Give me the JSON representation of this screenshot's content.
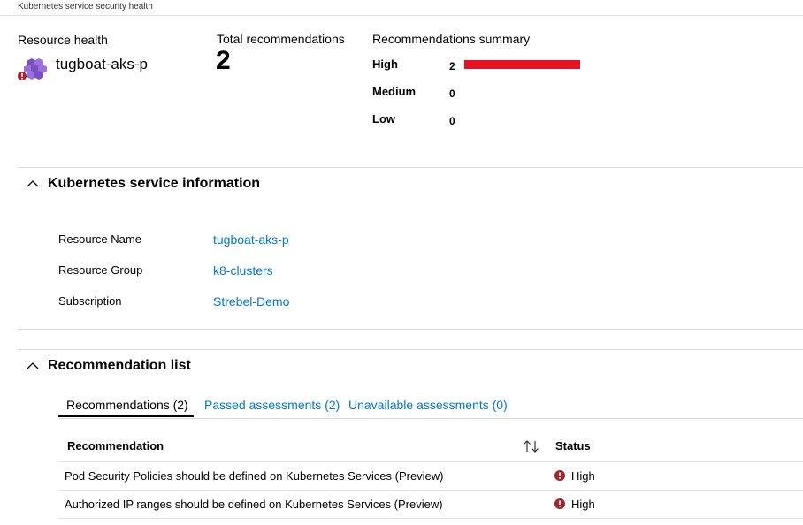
{
  "page": {
    "title": "Kubernetes service security health"
  },
  "overview": {
    "resource_health_label": "Resource health",
    "resource_name": "tugboat-aks-p",
    "total_label": "Total recommendations",
    "total_value": "2",
    "summary_label": "Recommendations summary",
    "severities": [
      {
        "name": "High",
        "count": "2",
        "bar_fraction": 1.0,
        "color": "#e81123"
      },
      {
        "name": "Medium",
        "count": "0",
        "bar_fraction": 0
      },
      {
        "name": "Low",
        "count": "0",
        "bar_fraction": 0
      }
    ]
  },
  "service_info": {
    "title": "Kubernetes service information",
    "rows": [
      {
        "key": "Resource Name",
        "value": "tugboat-aks-p"
      },
      {
        "key": "Resource Group",
        "value": "k8-clusters"
      },
      {
        "key": "Subscription",
        "value": "Strebel-Demo"
      }
    ]
  },
  "recommendation_list": {
    "title": "Recommendation list",
    "tabs": [
      {
        "label": "Recommendations (2)",
        "active": true
      },
      {
        "label": "Passed assessments (2)",
        "active": false
      },
      {
        "label": "Unavailable assessments (0)",
        "active": false
      }
    ],
    "columns": {
      "recommendation": "Recommendation",
      "status": "Status"
    },
    "rows": [
      {
        "recommendation": "Pod Security Policies should be defined on Kubernetes Services (Preview)",
        "status": "High"
      },
      {
        "recommendation": "Authorized IP ranges should be defined on Kubernetes Services (Preview)",
        "status": "High"
      }
    ]
  },
  "colors": {
    "link": "#0078d4",
    "danger": "#a4262c",
    "high_bar": "#e81123"
  }
}
